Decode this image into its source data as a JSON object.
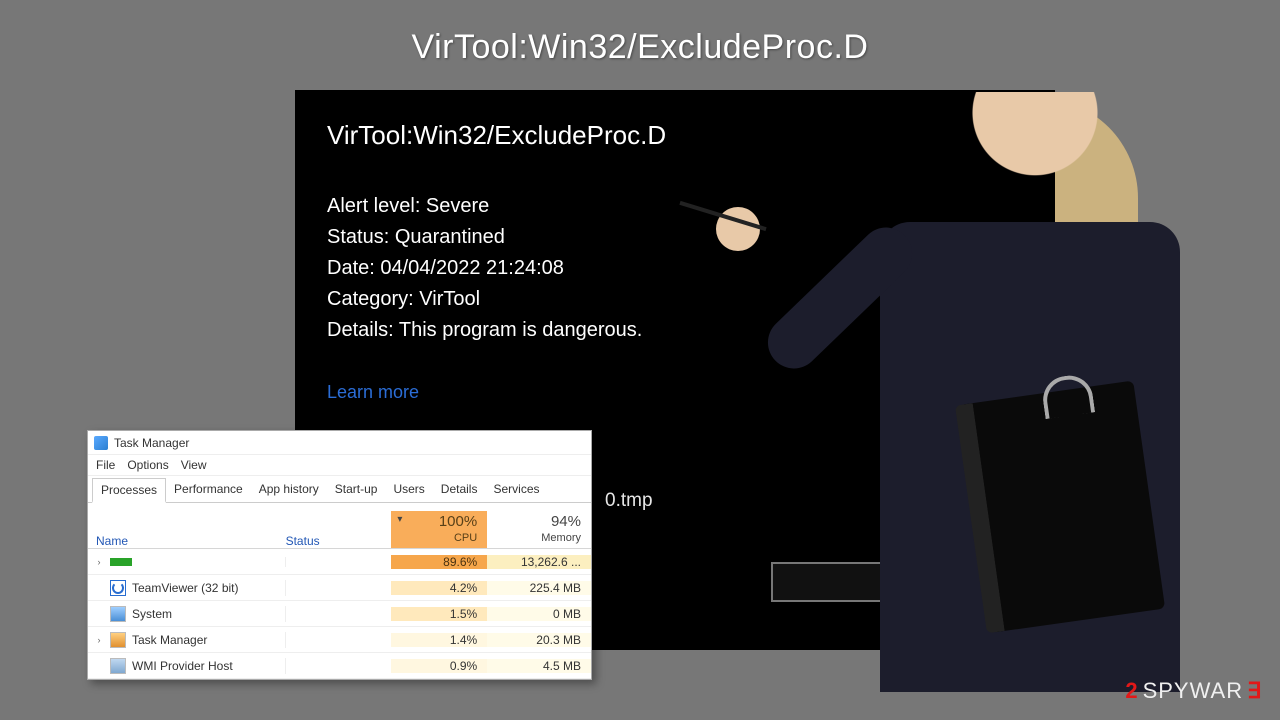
{
  "page": {
    "title": "VirTool:Win32/ExcludeProc.D"
  },
  "defender": {
    "title": "VirTool:Win32/ExcludeProc.D",
    "lines": {
      "alert": "Alert level: Severe",
      "status": "Status: Quarantined",
      "date": "Date: 04/04/2022 21:24:08",
      "category": "Category:  VirTool",
      "details": "Details:  This program is dangerous."
    },
    "learn_more": "Learn more",
    "tmp_fragment": "0.tmp"
  },
  "taskmgr": {
    "title": "Task Manager",
    "menu": [
      "File",
      "Options",
      "View"
    ],
    "tabs": [
      "Processes",
      "Performance",
      "App history",
      "Start-up",
      "Users",
      "Details",
      "Services"
    ],
    "active_tab": 0,
    "columns": {
      "name": "Name",
      "status": "Status",
      "cpu": {
        "value": "100%",
        "label": "CPU"
      },
      "memory": {
        "value": "94%",
        "label": "Memory"
      }
    },
    "rows": [
      {
        "expand": true,
        "icon": "bar",
        "name": "",
        "cpu": "89.6%",
        "mem": "13,262.6 ...",
        "cpu_cls": "cpu-high",
        "mem_cls": "mem-high"
      },
      {
        "expand": false,
        "icon": "tv",
        "name": "TeamViewer (32 bit)",
        "cpu": "4.2%",
        "mem": "225.4 MB",
        "cpu_cls": "cpu-med",
        "mem_cls": "mem-low"
      },
      {
        "expand": false,
        "icon": "sys",
        "name": "System",
        "cpu": "1.5%",
        "mem": "0 MB",
        "cpu_cls": "cpu-med",
        "mem_cls": "mem-low"
      },
      {
        "expand": true,
        "icon": "tm",
        "name": "Task Manager",
        "cpu": "1.4%",
        "mem": "20.3 MB",
        "cpu_cls": "cpu-low",
        "mem_cls": "mem-low"
      },
      {
        "expand": false,
        "icon": "wmi",
        "name": "WMI Provider Host",
        "cpu": "0.9%",
        "mem": "4.5 MB",
        "cpu_cls": "cpu-low",
        "mem_cls": "mem-low"
      }
    ]
  },
  "watermark": {
    "num": "2",
    "text": "SPYWAR",
    "tail": "∃"
  }
}
